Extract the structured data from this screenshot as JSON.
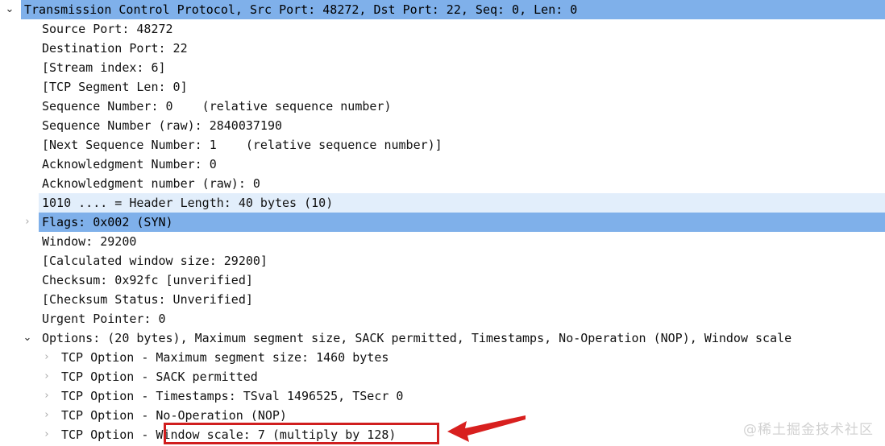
{
  "header": {
    "summary": "Transmission Control Protocol, Src Port: 48272, Dst Port: 22, Seq: 0, Len: 0",
    "expander": "chevron-down"
  },
  "colors": {
    "selection_blue": "#7fb0ea",
    "soft_highlight": "#e2eefb",
    "annotation_red": "#d01e1e",
    "text": "#111111",
    "chevron_active": "#2b2b2b",
    "chevron_inactive": "#a8a8a8",
    "watermark": "#d2d2d2",
    "background": "#ffffff"
  },
  "rows": [
    {
      "text": "Source Port: 48272",
      "indent": 1,
      "chevron": "none",
      "highlight": "none"
    },
    {
      "text": "Destination Port: 22",
      "indent": 1,
      "chevron": "none",
      "highlight": "none"
    },
    {
      "text": "[Stream index: 6]",
      "indent": 1,
      "chevron": "none",
      "highlight": "none"
    },
    {
      "text": "[TCP Segment Len: 0]",
      "indent": 1,
      "chevron": "none",
      "highlight": "none"
    },
    {
      "text": "Sequence Number: 0    (relative sequence number)",
      "indent": 1,
      "chevron": "none",
      "highlight": "none"
    },
    {
      "text": "Sequence Number (raw): 2840037190",
      "indent": 1,
      "chevron": "none",
      "highlight": "none"
    },
    {
      "text": "[Next Sequence Number: 1    (relative sequence number)]",
      "indent": 1,
      "chevron": "none",
      "highlight": "none"
    },
    {
      "text": "Acknowledgment Number: 0",
      "indent": 1,
      "chevron": "none",
      "highlight": "none"
    },
    {
      "text": "Acknowledgment number (raw): 0",
      "indent": 1,
      "chevron": "none",
      "highlight": "none"
    },
    {
      "text": "1010 .... = Header Length: 40 bytes (10)",
      "indent": 1,
      "chevron": "none",
      "highlight": "soft"
    },
    {
      "text": "Flags: 0x002 (SYN)",
      "indent": 1,
      "chevron": "chevron-right",
      "highlight": "selected"
    },
    {
      "text": "Window: 29200",
      "indent": 1,
      "chevron": "none",
      "highlight": "none"
    },
    {
      "text": "[Calculated window size: 29200]",
      "indent": 1,
      "chevron": "none",
      "highlight": "none"
    },
    {
      "text": "Checksum: 0x92fc [unverified]",
      "indent": 1,
      "chevron": "none",
      "highlight": "none"
    },
    {
      "text": "[Checksum Status: Unverified]",
      "indent": 1,
      "chevron": "none",
      "highlight": "none"
    },
    {
      "text": "Urgent Pointer: 0",
      "indent": 1,
      "chevron": "none",
      "highlight": "none"
    },
    {
      "text": "Options: (20 bytes), Maximum segment size, SACK permitted, Timestamps, No-Operation (NOP), Window scale",
      "indent": 1,
      "chevron": "chevron-down",
      "highlight": "none"
    },
    {
      "text": "TCP Option - Maximum segment size: 1460 bytes",
      "indent": 2,
      "chevron": "chevron-right",
      "highlight": "none"
    },
    {
      "text": "TCP Option - SACK permitted",
      "indent": 2,
      "chevron": "chevron-right",
      "highlight": "none"
    },
    {
      "text": "TCP Option - Timestamps: TSval 1496525, TSecr 0",
      "indent": 2,
      "chevron": "chevron-right",
      "highlight": "none"
    },
    {
      "text": "TCP Option - No-Operation (NOP)",
      "indent": 2,
      "chevron": "chevron-right",
      "highlight": "none"
    },
    {
      "text": "TCP Option - Window scale: 7 (multiply by 128)",
      "indent": 2,
      "chevron": "chevron-right",
      "highlight": "none"
    }
  ],
  "annotation": {
    "boxed_text": "Window scale: 7 (multiply by 128)",
    "arrow": "left-arrow"
  },
  "watermark": {
    "text": "@稀土掘金技术社区"
  },
  "glyphs": {
    "chevron_down": "⌄",
    "chevron_right": "›"
  }
}
